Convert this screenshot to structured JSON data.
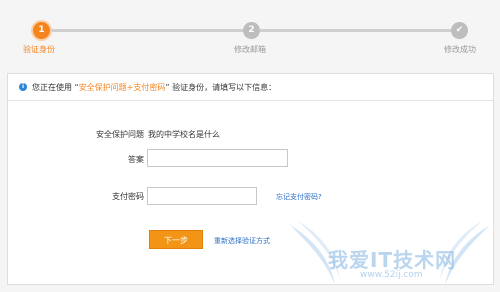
{
  "steps": [
    {
      "number": "1",
      "label": "验证身份"
    },
    {
      "number": "2",
      "label": "修改邮箱"
    },
    {
      "number": "✔",
      "label": "修改成功"
    }
  ],
  "notice": {
    "prefix": "您正在使用 “",
    "method": "安全保护问题+支付密码",
    "suffix": "” 验证身份，请填写以下信息："
  },
  "form": {
    "question_label": "安全保护问题",
    "question_value": "我的中学校名是什么",
    "answer_label": "答案",
    "answer_value": "",
    "password_label": "支付密码",
    "password_value": "",
    "forgot_link": "忘记支付密码?",
    "next_button": "下一步",
    "reselect_link": "重新选择验证方式"
  },
  "watermark": {
    "text": "我爱IT技术网",
    "url": "www.52ij.com"
  },
  "colors": {
    "accent": "#f5841f",
    "link": "#2b6fc9",
    "info": "#2b86d6"
  }
}
